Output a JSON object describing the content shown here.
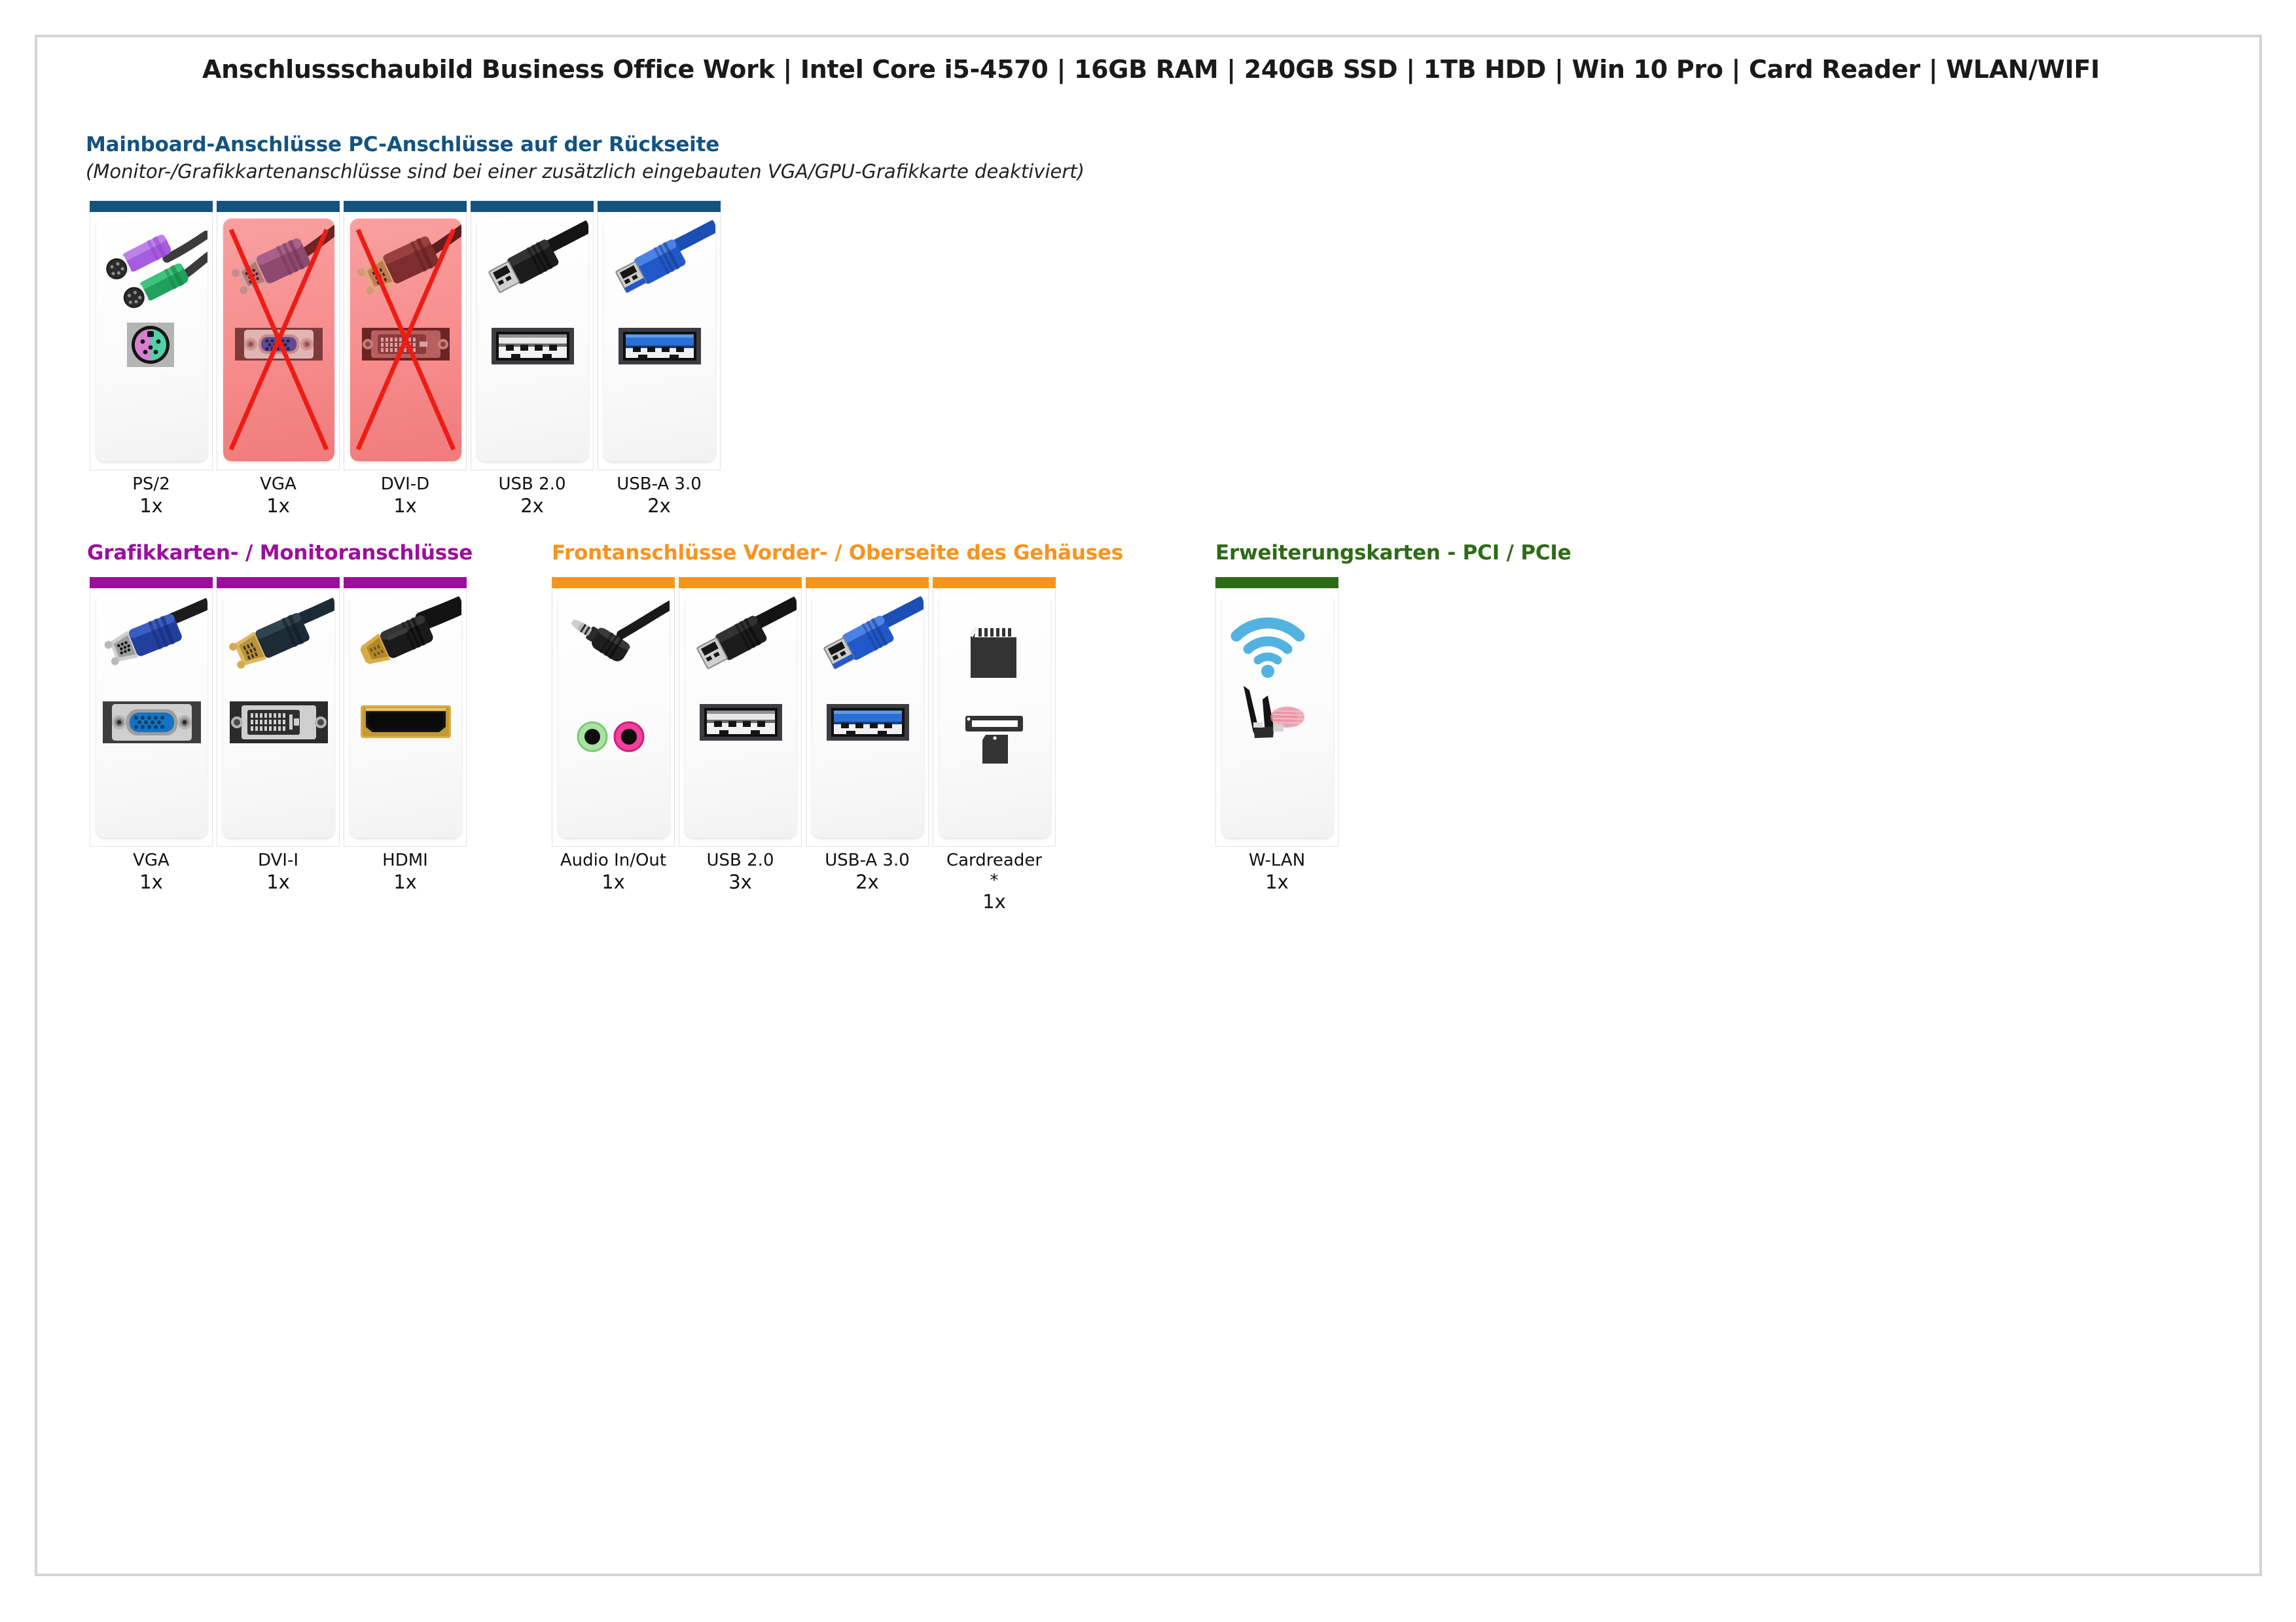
{
  "title": "Anschlussschaubild Business Office Work | Intel Core i5-4570 | 16GB RAM | 240GB SSD | 1TB HDD | Win 10 Pro | Card Reader | WLAN/WIFI",
  "colors": {
    "rear_accent": "#14537f",
    "gpu_accent": "#9c0f9c",
    "front_accent": "#f7941e",
    "pci_accent": "#2e6b16",
    "rear_heading": "#14537f",
    "gpu_heading": "#9c0f9c",
    "front_heading": "#f7941e",
    "pci_heading": "#2e6b16",
    "disabled_overlay": "#f78c8c",
    "cross_line": "#ee1c15",
    "page_border": "#d4d4d4"
  },
  "sections": [
    {
      "id": "rear",
      "heading": "Mainboard-Anschlüsse PC-Anschlüsse auf der Rückseite",
      "subheading": "(Monitor-/Grafikkartenanschlüsse sind bei einer zusätzlich eingebauten VGA/GPU-Grafikkarte deaktiviert)",
      "cards": [
        {
          "label": "PS/2",
          "count": "1x",
          "icon": "ps2-connector-icon",
          "disabled": false
        },
        {
          "label": "VGA",
          "count": "1x",
          "icon": "vga-connector-icon",
          "disabled": true
        },
        {
          "label": "DVI-D",
          "count": "1x",
          "icon": "dvid-connector-icon",
          "disabled": true
        },
        {
          "label": "USB 2.0",
          "count": "2x",
          "icon": "usb2-connector-icon",
          "disabled": false
        },
        {
          "label": "USB-A 3.0",
          "count": "2x",
          "icon": "usb3-connector-icon",
          "disabled": false
        }
      ]
    },
    {
      "id": "gpu",
      "heading": "Grafikkarten- / Monitoranschlüsse",
      "subheading": "",
      "cards": [
        {
          "label": "VGA",
          "count": "1x",
          "icon": "vga-blue-connector-icon",
          "disabled": false
        },
        {
          "label": "DVI-I",
          "count": "1x",
          "icon": "dvii-connector-icon",
          "disabled": false
        },
        {
          "label": "HDMI",
          "count": "1x",
          "icon": "hdmi-connector-icon",
          "disabled": false
        }
      ]
    },
    {
      "id": "front",
      "heading": "Frontanschlüsse Vorder- / Oberseite des Gehäuses",
      "subheading": "",
      "cards": [
        {
          "label": "Audio In/Out",
          "count": "1x",
          "icon": "audio-jack-icon",
          "disabled": false
        },
        {
          "label": "USB 2.0",
          "count": "3x",
          "icon": "usb2-connector-icon",
          "disabled": false
        },
        {
          "label": "USB-A 3.0",
          "count": "2x",
          "icon": "usb3-connector-icon",
          "disabled": false
        },
        {
          "label": "Cardreader\n*",
          "count": "1x",
          "icon": "cardreader-icon",
          "disabled": false
        }
      ]
    },
    {
      "id": "pci",
      "heading": "Erweiterungskarten - PCI / PCIe",
      "subheading": "",
      "cards": [
        {
          "label": "W-LAN",
          "count": "1x",
          "icon": "wlan-antenna-icon",
          "disabled": false
        }
      ]
    }
  ]
}
